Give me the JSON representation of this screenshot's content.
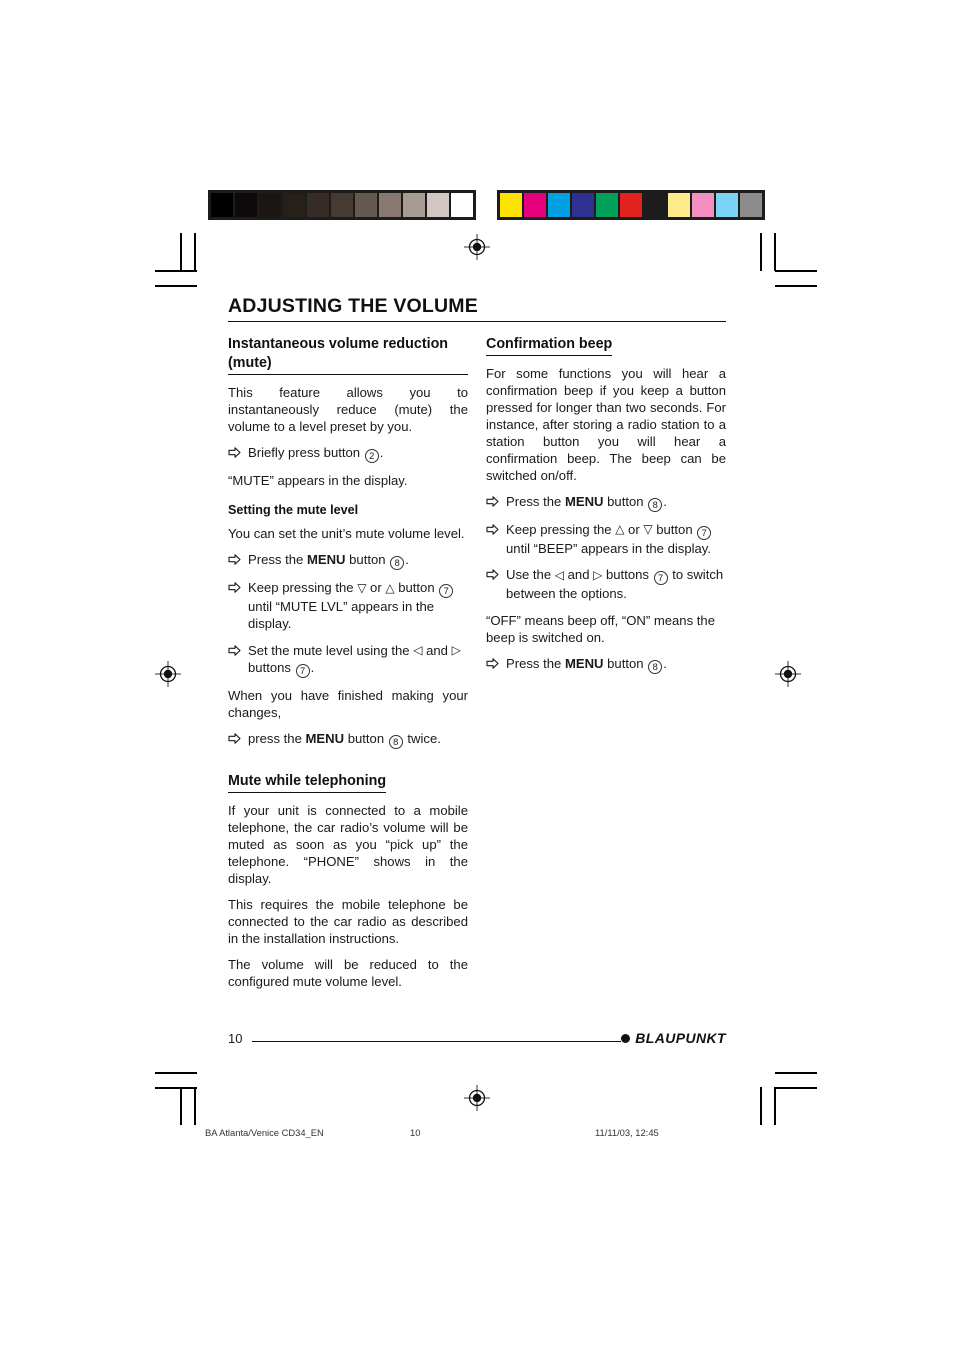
{
  "calibration": {
    "gray_bar_name": "grayscale-calibration-bar",
    "gray_swatches": [
      "#000000",
      "#0d0a09",
      "#1b1513",
      "#272019",
      "#362c25",
      "#463a31",
      "#645850",
      "#87796f",
      "#a89b93",
      "#d2c7c2",
      "#ffffff"
    ],
    "color_bar_name": "color-calibration-bar",
    "color_swatches": [
      "#fde100",
      "#e5007d",
      "#00a0e3",
      "#2e3192",
      "#00a05a",
      "#e3221d",
      "#1c1c1c",
      "#fdea8a",
      "#f58fc2",
      "#79d4f5",
      "#8c8c8c"
    ]
  },
  "page": {
    "title": "ADJUSTING THE VOLUME",
    "number": "10"
  },
  "left_column": {
    "heading": "Instantaneous volume reduction (mute)",
    "intro": "This feature allows you to instantaneously reduce (mute) the volume to a level preset by you.",
    "bullet_1_pre": "Briefly press button ",
    "bullet_1_ref": "2",
    "bullet_1_post": ".",
    "after_bullet_1": "“MUTE” appears in the display.",
    "sub_heading": "Setting the mute level",
    "sub_intro": "You can set the unit’s mute volume level.",
    "bullet_2_pre": "Press the ",
    "bullet_2_bold": "MENU",
    "bullet_2_mid": " button ",
    "bullet_2_ref": "8",
    "bullet_2_post": ".",
    "bullet_3_pre": "Keep pressing the ",
    "bullet_3_glyph_a": "▽",
    "bullet_3_mid": " or ",
    "bullet_3_glyph_b": "△",
    "bullet_3_mid2": " button ",
    "bullet_3_ref": "7",
    "bullet_3_post": " until “MUTE LVL” appears in the display.",
    "bullet_4_pre": "Set the mute level using the ",
    "bullet_4_glyph_a": "◁",
    "bullet_4_mid": " and ",
    "bullet_4_glyph_b": "▷",
    "bullet_4_mid2": " buttons ",
    "bullet_4_ref": "7",
    "bullet_4_post": ".",
    "after_bullet_4": "When you have finished making your changes,",
    "bullet_5_pre": "press the ",
    "bullet_5_bold": "MENU",
    "bullet_5_mid": " button ",
    "bullet_5_ref": "8",
    "bullet_5_post": " twice.",
    "heading_2": "Mute while telephoning",
    "para_1": "If your unit is connected to a mobile telephone, the car radio’s volume will be muted as soon as you “pick up” the telephone. “PHONE” shows in the display.",
    "para_2": "This requires the mobile telephone be connected to the car radio as described in the installation instructions.",
    "para_3": "The volume will be reduced to the configured mute volume level."
  },
  "right_column": {
    "heading": "Confirmation beep",
    "intro": "For some functions you will hear a confirmation beep if you keep a button pressed for longer than two seconds. For instance, after storing a radio station to a station button you will hear a confirmation beep. The beep can be switched on/off.",
    "bullet_1_pre": "Press the ",
    "bullet_1_bold": "MENU",
    "bullet_1_mid": " button ",
    "bullet_1_ref": "8",
    "bullet_1_post": ".",
    "bullet_2_pre": "Keep pressing the ",
    "bullet_2_glyph_a": "△",
    "bullet_2_mid": " or ",
    "bullet_2_glyph_b": "▽",
    "bullet_2_mid2": " button ",
    "bullet_2_ref": "7",
    "bullet_2_post": " until “BEEP” appears in the display.",
    "bullet_3_pre": "Use the ",
    "bullet_3_glyph_a": "◁",
    "bullet_3_mid": " and ",
    "bullet_3_glyph_b": "▷",
    "bullet_3_mid2": " buttons ",
    "bullet_3_ref": "7",
    "bullet_3_post": " to switch between the options.",
    "after_bullet_3": "“OFF” means beep off, “ON” means the beep is switched on.",
    "bullet_4_pre": "Press the ",
    "bullet_4_bold": "MENU",
    "bullet_4_mid": " button ",
    "bullet_4_ref": "8",
    "bullet_4_post": "."
  },
  "brand": {
    "name": "BLAUPUNKT"
  },
  "print_slug": {
    "file": "BA Atlanta/Venice CD34_EN",
    "page": "10",
    "date": "11/11/03, 12:45"
  },
  "icons": {
    "bullet_arrow": "hollow-right-arrow-icon",
    "registration_target": "registration-target-icon"
  }
}
